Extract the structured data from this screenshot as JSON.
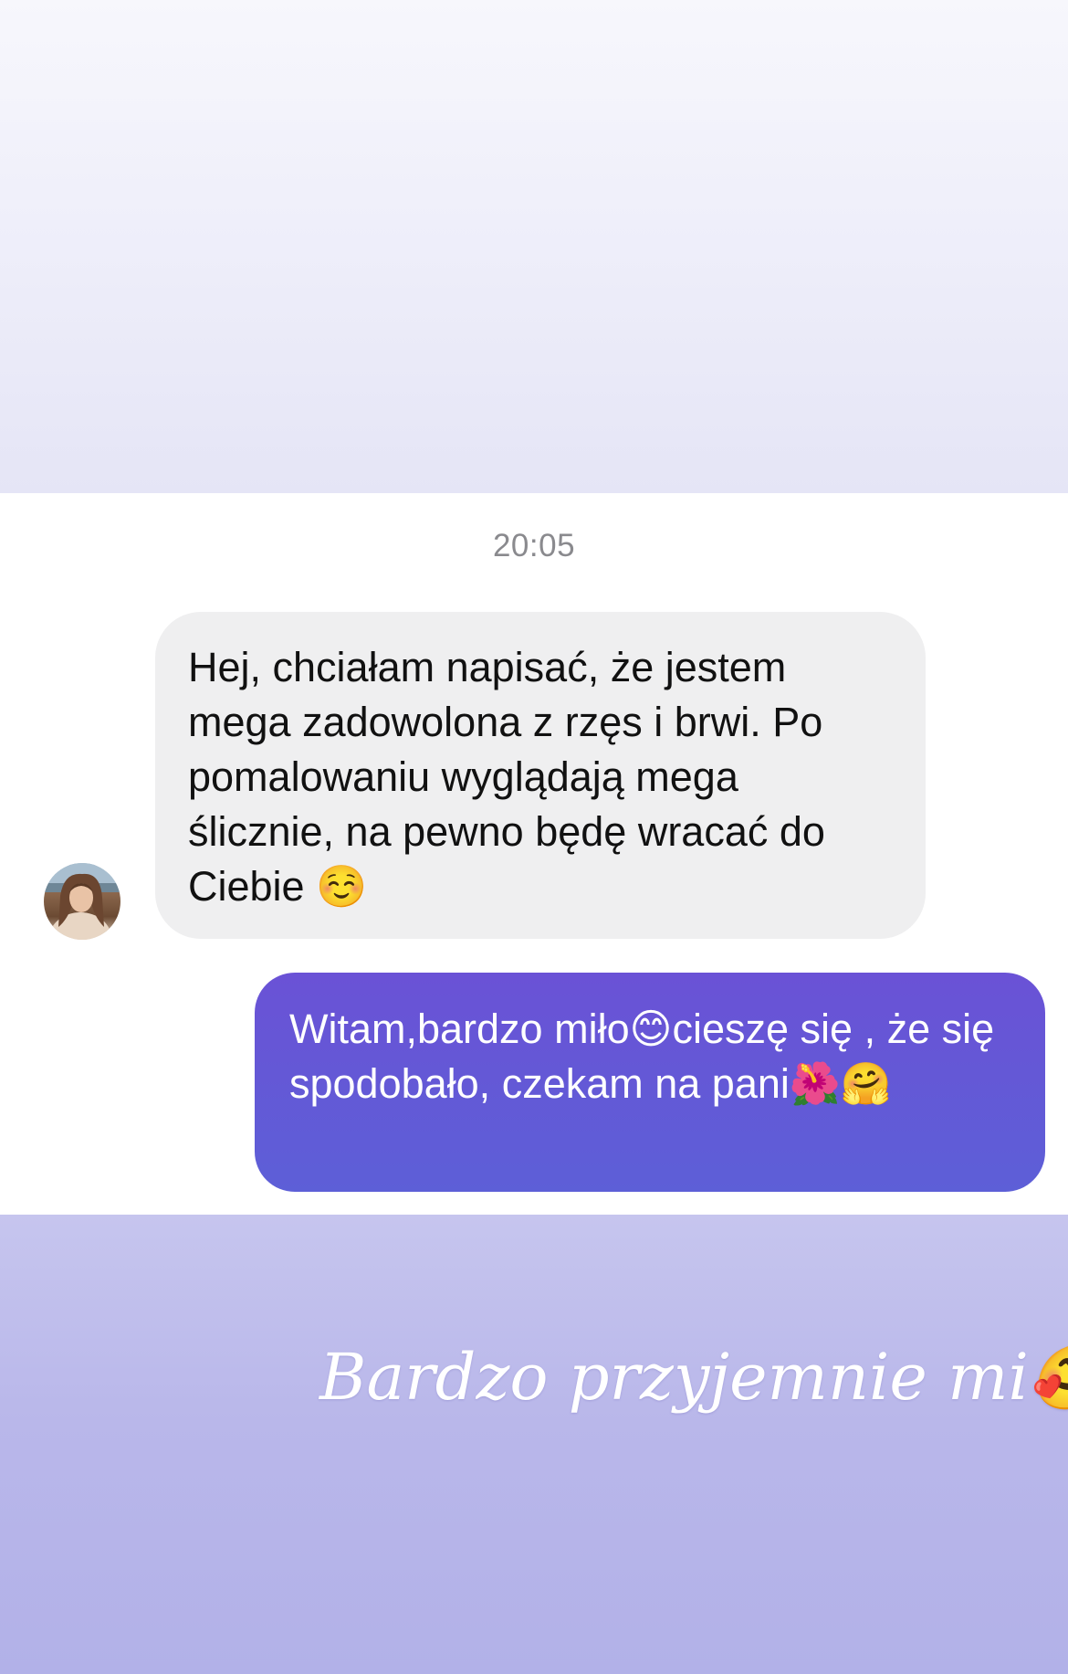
{
  "conversation": {
    "timestamp": "20:05",
    "messages": [
      {
        "direction": "incoming",
        "text": "Hej, chciałam napisać, że jestem mega zadowolona z rzęs i brwi. Po pomalowaniu wyglądają mega ślicznie, na pewno będę wracać do Ciebie ☺️"
      },
      {
        "direction": "outgoing",
        "text": "Witam,bardzo miło😊cieszę się , że się spodobało, czekam na pani🌺🤗"
      }
    ]
  },
  "story_caption": "Bardzo przyjemnie mi🥰",
  "colors": {
    "incoming_bubble": "#efeff0",
    "outgoing_bubble": "#6a52d6",
    "timestamp_text": "#8a8a8e",
    "caption_text": "#ffffff"
  }
}
